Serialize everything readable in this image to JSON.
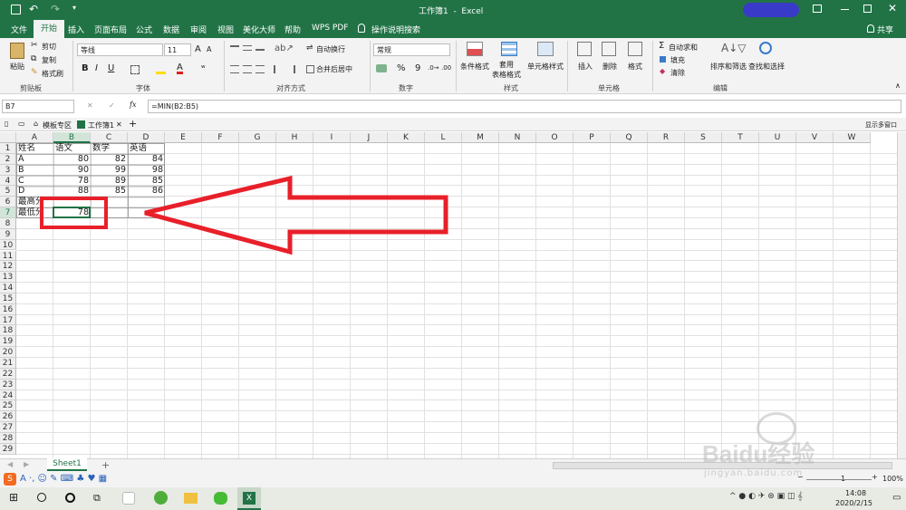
{
  "window": {
    "title": "工作簿1  -  Excel",
    "restore_icon": "restore-icon",
    "minimize_icon": "minimize-icon",
    "close_icon": "close-icon"
  },
  "menu": {
    "items": [
      "文件",
      "开始",
      "插入",
      "页面布局",
      "公式",
      "数据",
      "审阅",
      "视图",
      "美化大师",
      "帮助",
      "WPS PDF"
    ],
    "active": "开始",
    "tell_me": "操作说明搜索",
    "share": "共享"
  },
  "ribbon": {
    "clipboard": {
      "paste": "粘贴",
      "cut": "剪切",
      "copy": "复制",
      "format_painter": "格式刷",
      "label": "剪贴板"
    },
    "font": {
      "name": "等线",
      "size": "11",
      "bold": "B",
      "italic": "I",
      "underline": "U",
      "label": "字体",
      "grow": "A",
      "shrink": "A"
    },
    "alignment": {
      "wrap": "自动换行",
      "merge": "合并后居中",
      "label": "对齐方式"
    },
    "number": {
      "format": "常规",
      "percent": "%",
      "comma": "9",
      "label": "数字"
    },
    "styles": {
      "conditional": "条件格式",
      "table": "套用\n表格格式",
      "cell_styles": "单元格样式",
      "label": "样式"
    },
    "cells": {
      "insert": "插入",
      "delete": "删除",
      "format": "格式",
      "label": "单元格"
    },
    "editing": {
      "autosum": "自动求和",
      "fill": "填充",
      "clear": "清除",
      "sort": "排序和筛选",
      "find": "查找和选择",
      "label": "编辑"
    }
  },
  "formula_bar": {
    "name_box": "B7",
    "fx": "fx",
    "formula": "=MIN(B2:B5)"
  },
  "doc_tabs": {
    "home": "模板专区",
    "workbook": "工作簿1",
    "add": "+",
    "show_multi": "显示多窗口"
  },
  "sheet": {
    "columns": [
      "A",
      "B",
      "C",
      "D",
      "E",
      "F",
      "G",
      "H",
      "I",
      "J",
      "K",
      "L",
      "M",
      "N",
      "O",
      "P",
      "Q",
      "R",
      "S",
      "T",
      "U",
      "V",
      "W"
    ],
    "rows": [
      "1",
      "2",
      "3",
      "4",
      "5",
      "6",
      "7",
      "8",
      "9",
      "10",
      "11",
      "12",
      "13",
      "14",
      "15",
      "16",
      "17",
      "18",
      "19",
      "20",
      "21",
      "22",
      "23",
      "24",
      "25",
      "26",
      "27",
      "28",
      "29"
    ],
    "cells": [
      {
        "r": 0,
        "c": 0,
        "v": "姓名"
      },
      {
        "r": 0,
        "c": 1,
        "v": "语文"
      },
      {
        "r": 0,
        "c": 2,
        "v": "数学"
      },
      {
        "r": 0,
        "c": 3,
        "v": "英语"
      },
      {
        "r": 1,
        "c": 0,
        "v": "A"
      },
      {
        "r": 1,
        "c": 1,
        "v": "80",
        "n": true
      },
      {
        "r": 1,
        "c": 2,
        "v": "82",
        "n": true
      },
      {
        "r": 1,
        "c": 3,
        "v": "84",
        "n": true
      },
      {
        "r": 2,
        "c": 0,
        "v": "B"
      },
      {
        "r": 2,
        "c": 1,
        "v": "90",
        "n": true
      },
      {
        "r": 2,
        "c": 2,
        "v": "99",
        "n": true
      },
      {
        "r": 2,
        "c": 3,
        "v": "98",
        "n": true
      },
      {
        "r": 3,
        "c": 0,
        "v": "C"
      },
      {
        "r": 3,
        "c": 1,
        "v": "78",
        "n": true
      },
      {
        "r": 3,
        "c": 2,
        "v": "89",
        "n": true
      },
      {
        "r": 3,
        "c": 3,
        "v": "85",
        "n": true
      },
      {
        "r": 4,
        "c": 0,
        "v": "D"
      },
      {
        "r": 4,
        "c": 1,
        "v": "88",
        "n": true
      },
      {
        "r": 4,
        "c": 2,
        "v": "85",
        "n": true
      },
      {
        "r": 4,
        "c": 3,
        "v": "86",
        "n": true
      },
      {
        "r": 5,
        "c": 0,
        "v": "最高分"
      },
      {
        "r": 6,
        "c": 0,
        "v": "最低分"
      },
      {
        "r": 6,
        "c": 1,
        "v": "78",
        "n": true
      }
    ],
    "tab": "Sheet1",
    "add_sheet": "+"
  },
  "status": {
    "zoom": "100%",
    "page": "1"
  },
  "taskbar": {
    "time": "14:08",
    "date": "2020/2/15"
  },
  "watermark": {
    "brand": "Baidu经验",
    "url": "jingyan.baidu.com"
  },
  "colors": {
    "excel_green": "#217346",
    "annotation_red": "#e8202a"
  }
}
